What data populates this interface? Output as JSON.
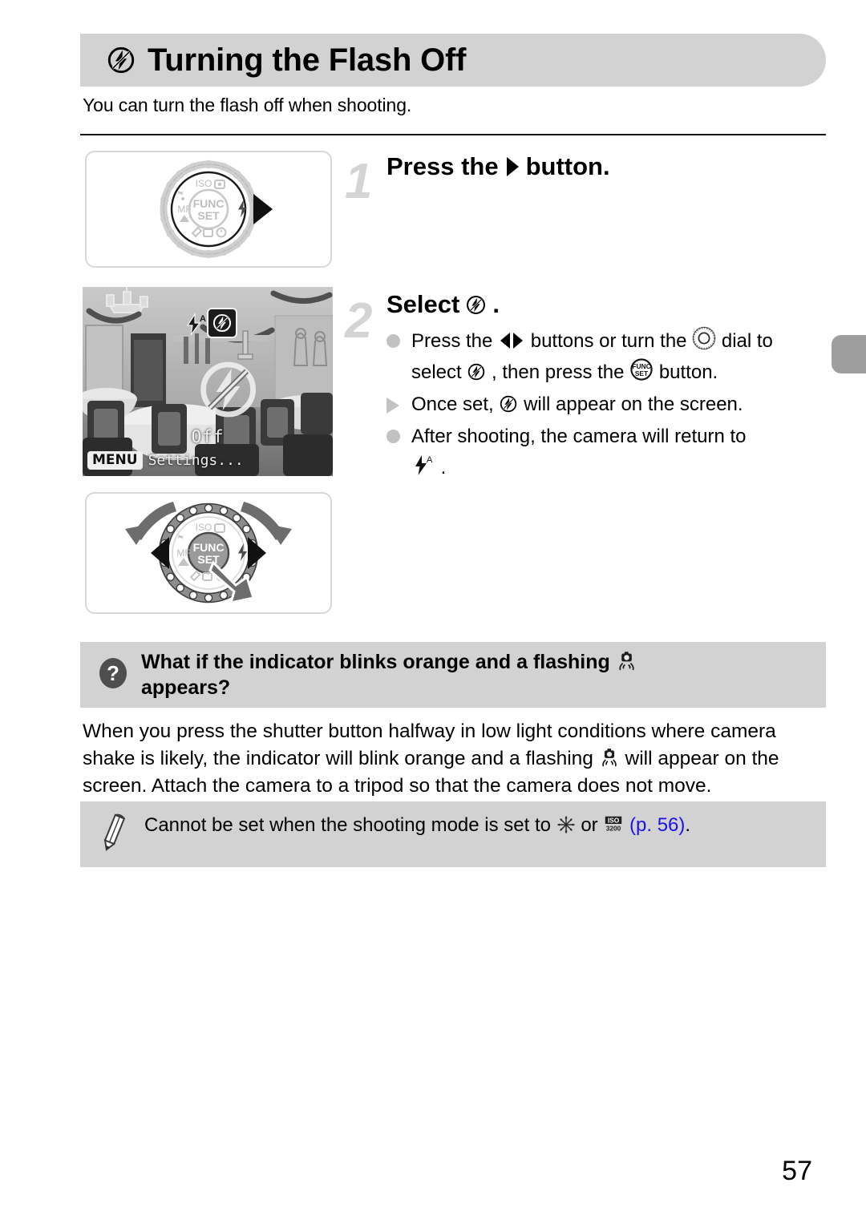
{
  "header": {
    "icon": "flash-off-icon",
    "title": "Turning the Flash Off"
  },
  "intro": "You can turn the flash off when shooting.",
  "steps": [
    {
      "number": "1",
      "title_before": "Press the",
      "title_icon": "right-arrow-button-icon",
      "title_after": "button."
    },
    {
      "number": "2",
      "title_before": "Select",
      "title_icon": "flash-off-icon",
      "title_after": ".",
      "bullets": [
        {
          "marker": "dot",
          "parts": [
            {
              "t": "text",
              "v": "Press the "
            },
            {
              "t": "icon",
              "v": "left-right-buttons-icon"
            },
            {
              "t": "text",
              "v": " buttons or turn the "
            },
            {
              "t": "icon",
              "v": "control-dial-icon"
            },
            {
              "t": "text",
              "v": " dial to select "
            },
            {
              "t": "icon",
              "v": "flash-off-icon"
            },
            {
              "t": "text",
              "v": ", then press the "
            },
            {
              "t": "icon",
              "v": "func-set-button-icon"
            },
            {
              "t": "text",
              "v": " button."
            }
          ]
        },
        {
          "marker": "triangle",
          "parts": [
            {
              "t": "text",
              "v": "Once set, "
            },
            {
              "t": "icon",
              "v": "flash-off-icon"
            },
            {
              "t": "text",
              "v": " will appear on the screen."
            }
          ]
        },
        {
          "marker": "dot",
          "parts": [
            {
              "t": "text",
              "v": "After shooting, the camera will return to "
            },
            {
              "t": "icon",
              "v": "flash-auto-icon"
            },
            {
              "t": "text",
              "v": " ."
            }
          ]
        }
      ]
    }
  ],
  "figures": {
    "dial": {
      "name": "camera-dial-illustration",
      "center_top": "FUNC",
      "center_bottom": "SET",
      "label_iso": "ISO",
      "label_mf": "MF"
    },
    "lcd": {
      "name": "camera-screen-illustration",
      "auto_flash_icon": "flash-auto-icon",
      "selected_icon": "flash-off-icon",
      "overlay_icon": "flash-off-icon",
      "status_label": "Off",
      "menu_chip": "MENU",
      "menu_label": "Settings..."
    },
    "press": {
      "name": "dial-press-illustration",
      "center_top": "FUNC",
      "center_bottom": "SET",
      "label_iso": "ISO",
      "label_mf": "MF"
    }
  },
  "qa": {
    "icon": "question-mark-icon",
    "line1_before": "What if the indicator blinks orange and a flashing",
    "line1_icon": "camera-shake-icon",
    "line2": "appears?",
    "body_parts": [
      {
        "t": "text",
        "v": "When you press the shutter button halfway in low light conditions where camera shake is likely, the indicator will blink orange and a flashing "
      },
      {
        "t": "icon",
        "v": "camera-shake-icon"
      },
      {
        "t": "text",
        "v": " will appear on the screen. Attach the camera to a tripod so that the camera does not move."
      }
    ]
  },
  "note": {
    "icon": "pencil-icon",
    "parts": [
      {
        "t": "text",
        "v": "Cannot be set when the shooting mode is set to "
      },
      {
        "t": "icon",
        "v": "fireworks-mode-icon"
      },
      {
        "t": "text",
        "v": " or "
      },
      {
        "t": "icon",
        "v": "iso-3200-mode-icon"
      },
      {
        "t": "text",
        "v": " "
      },
      {
        "t": "link",
        "v": "(p. 56)"
      },
      {
        "t": "text",
        "v": "."
      }
    ]
  },
  "page_number": "57",
  "colors": {
    "band_gray": "#d2d2d2",
    "step_number_gray": "#d4d4d4",
    "bullet_gray": "#c2c2c2",
    "tab_gray": "#9e9e9e",
    "link_blue": "#1b12e8"
  }
}
